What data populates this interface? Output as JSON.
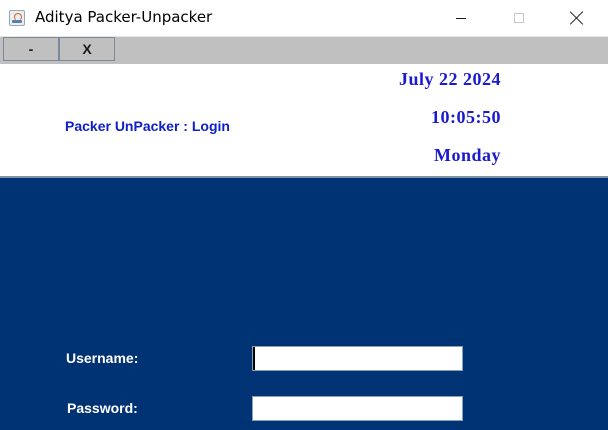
{
  "window": {
    "title": "Aditya Packer-Unpacker",
    "icon": "java-cup-icon"
  },
  "toolbar": {
    "minimize_label": "-",
    "close_label": "X"
  },
  "header": {
    "app_label": "Packer UnPacker : Login",
    "date": "July 22 2024",
    "time": "10:05:50",
    "day": "Monday"
  },
  "login": {
    "username_label": "Username:",
    "username_value": "",
    "password_label": "Password:",
    "password_value": ""
  },
  "colors": {
    "panel_background": "#003374",
    "toolbar_background": "#c0c0c0",
    "header_text": "#1a1acf",
    "app_label_text": "#0f20c8"
  }
}
